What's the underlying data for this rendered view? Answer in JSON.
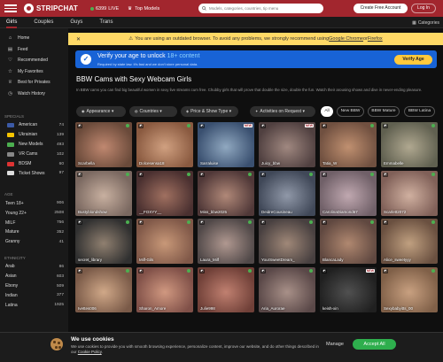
{
  "header": {
    "logo": "STRIPCHAT",
    "live_count": "6399",
    "live_label": "LIVE",
    "top_models": "Top Models",
    "search_placeholder": "Models, categories, countries, tip menu",
    "create_account": "Create Free Account",
    "login": "Log In"
  },
  "tabs": [
    "Girls",
    "Couples",
    "Guys",
    "Trans"
  ],
  "categories_label": "Categories",
  "sidebar": {
    "nav": [
      {
        "label": "Home",
        "icon": "home-icon"
      },
      {
        "label": "Feed",
        "icon": "feed-icon"
      },
      {
        "label": "Recommended",
        "icon": "heart-icon"
      },
      {
        "label": "My Favorites",
        "icon": "star-icon"
      },
      {
        "label": "Best for Privates",
        "icon": "crown-icon"
      },
      {
        "label": "Watch History",
        "icon": "clock-icon"
      }
    ],
    "specials_heading": "SPECIALS",
    "specials": [
      {
        "label": "American",
        "count": "74",
        "color": "#3c5aa6"
      },
      {
        "label": "Ukrainian",
        "count": "139",
        "color": "#f5c400"
      },
      {
        "label": "New Models",
        "count": "493",
        "color": "#4caf50"
      },
      {
        "label": "VR Cams",
        "count": "102",
        "color": "#888888"
      },
      {
        "label": "BDSM",
        "count": "60",
        "color": "#d33"
      },
      {
        "label": "Ticket Shows",
        "count": "97",
        "color": "#dddddd"
      }
    ],
    "age_heading": "AGE",
    "age": [
      {
        "label": "Teen 18+",
        "count": "906"
      },
      {
        "label": "Young 22+",
        "count": "2508"
      },
      {
        "label": "MILF",
        "count": "756"
      },
      {
        "label": "Mature",
        "count": "352"
      },
      {
        "label": "Granny",
        "count": "41"
      }
    ],
    "ethnicity_heading": "ETHNICITY",
    "ethnicity": [
      {
        "label": "Arab",
        "count": "86"
      },
      {
        "label": "Asian",
        "count": "603"
      },
      {
        "label": "Ebony",
        "count": "509"
      },
      {
        "label": "Indian",
        "count": "377"
      },
      {
        "label": "Latina",
        "count": "1925"
      }
    ]
  },
  "warning": {
    "text_before": "You are using an outdated browser. To avoid any problems, we strongly recommend using ",
    "link1": "Google Chrome",
    "or": " or ",
    "link2": "Firefox"
  },
  "verify": {
    "title_a": "Verify your age to unlock ",
    "title_b": "18+ content",
    "subtitle": "Required by state law. It's fast and we don't store personal data.",
    "button": "Verify Age"
  },
  "main": {
    "title": "BBW Cams with Sexy Webcam Girls",
    "description": "In BBW cams you can find big beautiful women in sexy live streams cum free. Chubby girls that will prove that double the size, double the fun. Watch their arousing shows and dive in never-ending pleasure."
  },
  "filters": {
    "appearance": "Appearance",
    "countries": "Countries",
    "price": "Price & Show Type",
    "activities": "Activities on Request",
    "pills": [
      "All",
      "New BBW",
      "BBW Mature",
      "BBW Latina"
    ]
  },
  "models": [
    {
      "name": "Scarbella",
      "c": [
        "#6a4a3a",
        "#c08870"
      ]
    },
    {
      "name": "Dolcesensa18",
      "c": [
        "#8a5a40",
        "#d0a080"
      ]
    },
    {
      "name": "Sarraluise",
      "c": [
        "#3a5070",
        "#90a8c0"
      ],
      "new": true
    },
    {
      "name": "Juicy_bbw",
      "c": [
        "#504040",
        "#a08880"
      ],
      "new": true
    },
    {
      "name": "Tatia_W",
      "c": [
        "#705040",
        "#c09070"
      ]
    },
    {
      "name": "Emmabelle",
      "c": [
        "#606050",
        "#b0a890"
      ]
    },
    {
      "name": "Bustyblondshow",
      "c": [
        "#7a6860",
        "#c8b0a0"
      ]
    },
    {
      "name": "__FOXYY__",
      "c": [
        "#4a3030",
        "#a07060"
      ]
    },
    {
      "name": "Miss_bbw2025",
      "c": [
        "#503838",
        "#b08878"
      ]
    },
    {
      "name": "DeidreCousineau",
      "c": [
        "#404858",
        "#9098a8"
      ]
    },
    {
      "name": "CarolinaDiamond67",
      "c": [
        "#706068",
        "#c0a8b0"
      ]
    },
    {
      "name": "Scarlett2072",
      "c": [
        "#806058",
        "#d0b0a0"
      ]
    },
    {
      "name": "secret_library",
      "c": [
        "#303030",
        "#908070"
      ]
    },
    {
      "name": "Milf-Gils",
      "c": [
        "#805848",
        "#c89878"
      ]
    },
    {
      "name": "Laura_Milf",
      "c": [
        "#504848",
        "#b09890"
      ]
    },
    {
      "name": "YourSweetDream_",
      "c": [
        "#484040",
        "#a08878"
      ]
    },
    {
      "name": "BlancaLady",
      "c": [
        "#604840",
        "#b08870"
      ]
    },
    {
      "name": "Alice_sweetyyy",
      "c": [
        "#6a5040",
        "#c0a080"
      ]
    },
    {
      "name": "Ivettes006",
      "c": [
        "#7a5a48",
        "#d0a888"
      ]
    },
    {
      "name": "Sharon_Amore",
      "c": [
        "#805048",
        "#d09880"
      ]
    },
    {
      "name": "Julie998",
      "c": [
        "#704038",
        "#c08070"
      ]
    },
    {
      "name": "Aria_Aurorae",
      "c": [
        "#5a4848",
        "#a89088"
      ]
    },
    {
      "name": "keish-xin",
      "c": [
        "#202020",
        "#505050"
      ],
      "new": true
    },
    {
      "name": "Sexybabyitts_00",
      "c": [
        "#806048",
        "#c8a080"
      ]
    }
  ],
  "cookie": {
    "title": "We use cookies",
    "text": "We use cookies to provide you with smooth browsing experience, personalize content, improve our website, and do other things described in our ",
    "link": "Cookie Policy",
    "manage": "Manage",
    "accept": "Accept All"
  }
}
